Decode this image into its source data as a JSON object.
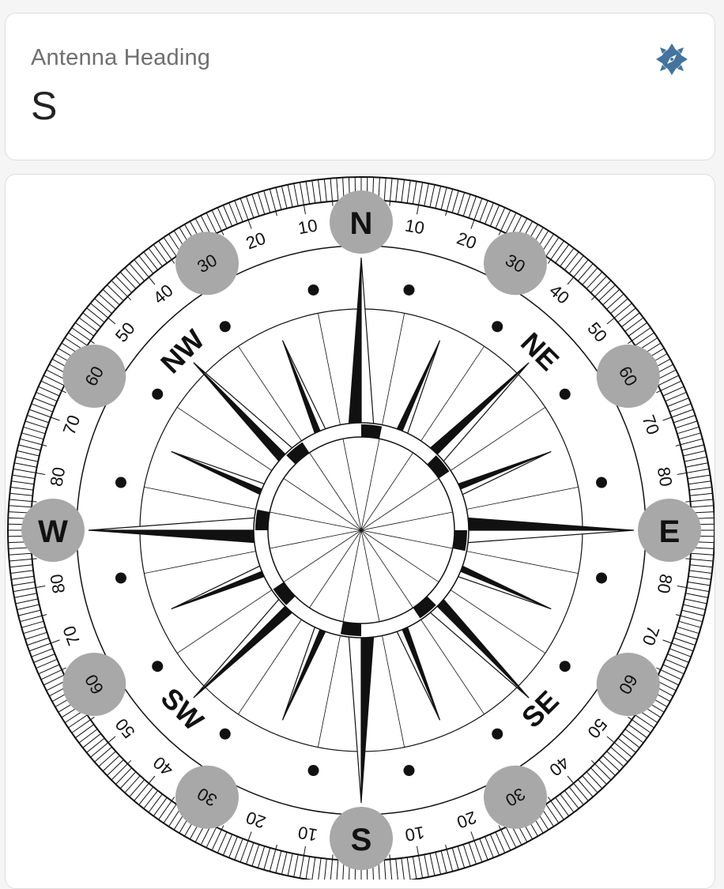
{
  "card": {
    "title": "Antenna Heading",
    "value": "S",
    "icon": "compass-icon",
    "icon_color": "#44739e"
  },
  "compass": {
    "cardinals": [
      "N",
      "E",
      "S",
      "W"
    ],
    "intercardinals": [
      "NE",
      "SE",
      "SW",
      "NW"
    ],
    "degree_labels": [
      "10",
      "20",
      "30",
      "40",
      "50",
      "60",
      "70",
      "80",
      "80",
      "70",
      "60",
      "50",
      "40",
      "30",
      "20",
      "10"
    ],
    "highlighted_labels": [
      "30",
      "60"
    ],
    "highlight_color": "#a8a8a8"
  }
}
